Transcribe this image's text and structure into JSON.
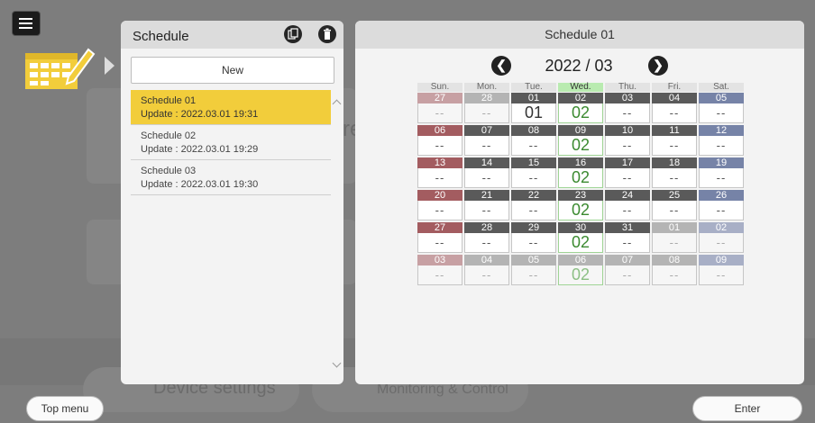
{
  "background": {
    "tile_text_1": "Device settings",
    "tile_text_2": "Monitoring & Control",
    "tile_letter": "re"
  },
  "left_panel": {
    "title": "Schedule",
    "copy_icon": "copy-icon",
    "delete_icon": "trash-icon",
    "new_label": "New",
    "items": [
      {
        "name": "Schedule 01",
        "update": "Update : 2022.03.01  19:31",
        "selected": true
      },
      {
        "name": "Schedule 02",
        "update": "Update : 2022.03.01  19:29",
        "selected": false
      },
      {
        "name": "Schedule 03",
        "update": "Update : 2022.03.01  19:30",
        "selected": false
      }
    ]
  },
  "right_panel": {
    "title": "Schedule 01",
    "prev_glyph": "❮",
    "next_glyph": "❯",
    "month": "2022 / 03",
    "days_of_week": [
      "Sun.",
      "Mon.",
      "Tue.",
      "Wed.",
      "Thu.",
      "Fri.",
      "Sat."
    ],
    "weeks": [
      [
        {
          "day": "27",
          "value": "--",
          "state": "out"
        },
        {
          "day": "28",
          "value": "--",
          "state": "out"
        },
        {
          "day": "01",
          "value": "01",
          "state": "in",
          "big": true
        },
        {
          "day": "02",
          "value": "02",
          "state": "in",
          "wed": true
        },
        {
          "day": "03",
          "value": "--",
          "state": "in"
        },
        {
          "day": "04",
          "value": "--",
          "state": "in"
        },
        {
          "day": "05",
          "value": "--",
          "state": "in"
        }
      ],
      [
        {
          "day": "06",
          "value": "--",
          "state": "in"
        },
        {
          "day": "07",
          "value": "--",
          "state": "in"
        },
        {
          "day": "08",
          "value": "--",
          "state": "in"
        },
        {
          "day": "09",
          "value": "02",
          "state": "in",
          "wed": true
        },
        {
          "day": "10",
          "value": "--",
          "state": "in"
        },
        {
          "day": "11",
          "value": "--",
          "state": "in"
        },
        {
          "day": "12",
          "value": "--",
          "state": "in"
        }
      ],
      [
        {
          "day": "13",
          "value": "--",
          "state": "in"
        },
        {
          "day": "14",
          "value": "--",
          "state": "in"
        },
        {
          "day": "15",
          "value": "--",
          "state": "in"
        },
        {
          "day": "16",
          "value": "02",
          "state": "in",
          "wed": true
        },
        {
          "day": "17",
          "value": "--",
          "state": "in"
        },
        {
          "day": "18",
          "value": "--",
          "state": "in"
        },
        {
          "day": "19",
          "value": "--",
          "state": "in"
        }
      ],
      [
        {
          "day": "20",
          "value": "--",
          "state": "in"
        },
        {
          "day": "21",
          "value": "--",
          "state": "in"
        },
        {
          "day": "22",
          "value": "--",
          "state": "in"
        },
        {
          "day": "23",
          "value": "02",
          "state": "in",
          "wed": true
        },
        {
          "day": "24",
          "value": "--",
          "state": "in"
        },
        {
          "day": "25",
          "value": "--",
          "state": "in"
        },
        {
          "day": "26",
          "value": "--",
          "state": "in"
        }
      ],
      [
        {
          "day": "27",
          "value": "--",
          "state": "in"
        },
        {
          "day": "28",
          "value": "--",
          "state": "in"
        },
        {
          "day": "29",
          "value": "--",
          "state": "in"
        },
        {
          "day": "30",
          "value": "02",
          "state": "in",
          "wed": true
        },
        {
          "day": "31",
          "value": "--",
          "state": "in"
        },
        {
          "day": "01",
          "value": "--",
          "state": "out"
        },
        {
          "day": "02",
          "value": "--",
          "state": "out"
        }
      ],
      [
        {
          "day": "03",
          "value": "--",
          "state": "out"
        },
        {
          "day": "04",
          "value": "--",
          "state": "out"
        },
        {
          "day": "05",
          "value": "--",
          "state": "out"
        },
        {
          "day": "06",
          "value": "02",
          "state": "out",
          "wed": true
        },
        {
          "day": "07",
          "value": "--",
          "state": "out"
        },
        {
          "day": "08",
          "value": "--",
          "state": "out"
        },
        {
          "day": "09",
          "value": "--",
          "state": "out"
        }
      ]
    ],
    "colors": {
      "sun_in": "#a35c60",
      "sun_out": "#c7a0a3",
      "sat_in": "#7683a7",
      "sat_out": "#a8afc6",
      "week_in": "#5a5a5a",
      "week_out": "#b4b4b4",
      "wed_head": "#9dd092"
    }
  },
  "footer": {
    "top_menu": "Top menu",
    "enter": "Enter"
  },
  "colors": {
    "selected": "#f2cd3b",
    "panel": "#f3f3f3",
    "overlay": "#7d7d7d"
  }
}
